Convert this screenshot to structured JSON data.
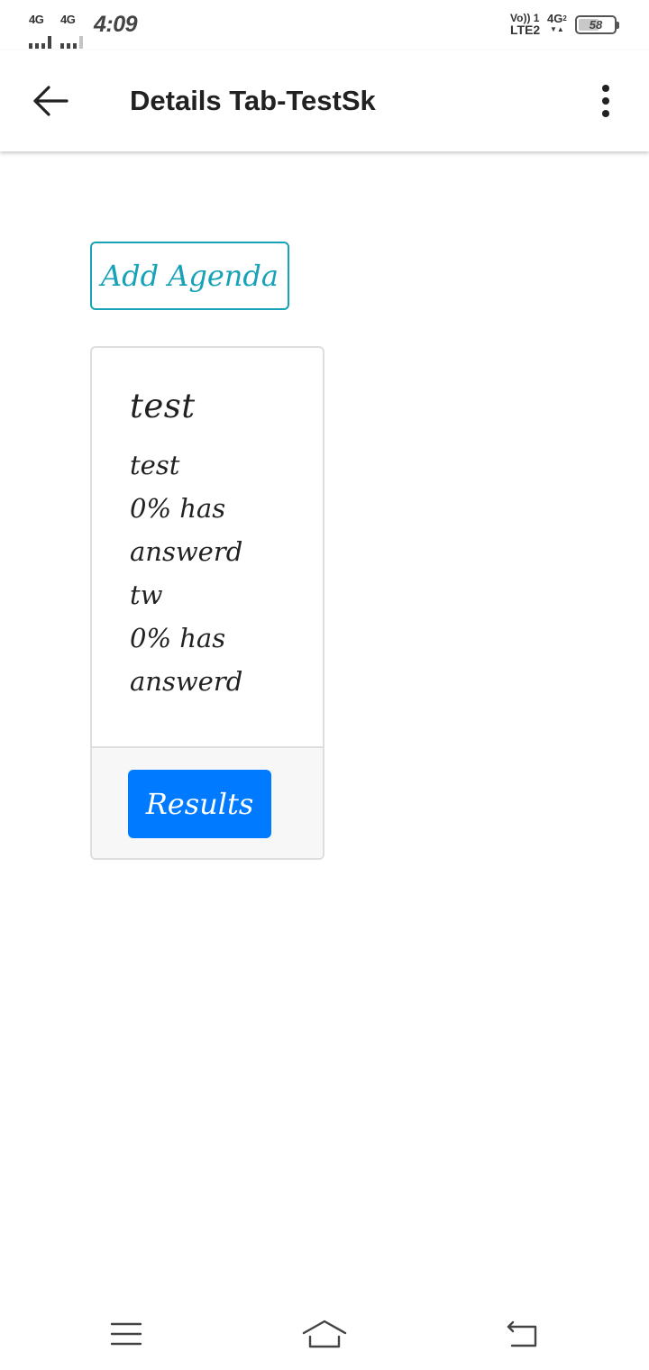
{
  "status_bar": {
    "sim1_network": "4G",
    "sim2_network": "4G",
    "time": "4:09",
    "volte_line1": "Vo)) 1",
    "volte_line2": "LTE2",
    "data_network": "4G",
    "data_sim": "2",
    "battery_level": "58"
  },
  "app_bar": {
    "title": "Details Tab-TestSk",
    "back_icon": "arrow-left-icon",
    "more_icon": "more-vertical-icon"
  },
  "content": {
    "add_agenda_label": "Add Agenda",
    "card": {
      "title": "test",
      "items": [
        {
          "name": "test",
          "answered_line1": "0% has",
          "answered_line2": "answerd"
        },
        {
          "name": "tw",
          "answered_line1": "0% has",
          "answered_line2": "answerd"
        }
      ],
      "results_label": "Results"
    }
  },
  "nav_bar": {
    "menu_icon": "menu-icon",
    "home_icon": "home-icon",
    "back_icon": "return-icon"
  },
  "colors": {
    "accent_outline": "#17a2b8",
    "primary_button": "#007bff",
    "text": "#212121",
    "card_border": "#dedede",
    "card_footer_bg": "#f7f7f7"
  }
}
